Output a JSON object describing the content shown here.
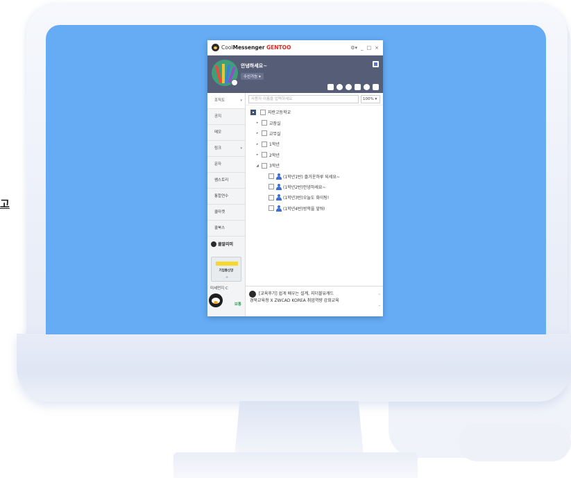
{
  "side_label": "고",
  "app": {
    "title_prefix": "Cool",
    "title_bold": "Messenger",
    "title_brand": "GENTOO",
    "window_controls": [
      "⚙▾",
      "_",
      "□",
      "×"
    ]
  },
  "profile": {
    "greeting": "안녕하세요~",
    "status": "수신가능 ▾"
  },
  "sidebar": {
    "items": [
      {
        "label": "조직도",
        "chev": "▾"
      },
      {
        "label": "공지",
        "chev": ""
      },
      {
        "label": "메모",
        "chev": ""
      },
      {
        "label": "링크",
        "chev": "▾"
      },
      {
        "label": "문자",
        "chev": ""
      },
      {
        "label": "쌤스토리",
        "chev": ""
      },
      {
        "label": "통합연수",
        "chev": ""
      },
      {
        "label": "쿨마켓",
        "chev": ""
      },
      {
        "label": "쿨북스",
        "chev": ""
      }
    ],
    "coolally": "쿨알리미",
    "promo": "기업통신망",
    "promo_plus": "+",
    "message": "미세먼지 C",
    "send": "보통"
  },
  "search": {
    "placeholder": "사용자 이름을 입력하세요.",
    "zoom": "100% ▾"
  },
  "tree": {
    "root": "지란고등학교",
    "groups": [
      "교장실",
      "교무실",
      "1학년",
      "2학년",
      "3학년"
    ],
    "members": [
      "(1학년1반) 즐거운하루 되세요~",
      "(1학년2반)안녕하세요~",
      "(1학년3반)오늘도 화이팅!",
      "(1학년4반)방학을 앞둬!"
    ]
  },
  "notice": {
    "line1": "[교육후기] 쉽게 배우는 설계, 지더블유캐드",
    "line2": "경북교육청 X ZWCAD KOREA 취업역량 강화교육"
  },
  "colors": {
    "screen": "#65acf5",
    "header": "#565d77",
    "brand": "#e8271e"
  }
}
